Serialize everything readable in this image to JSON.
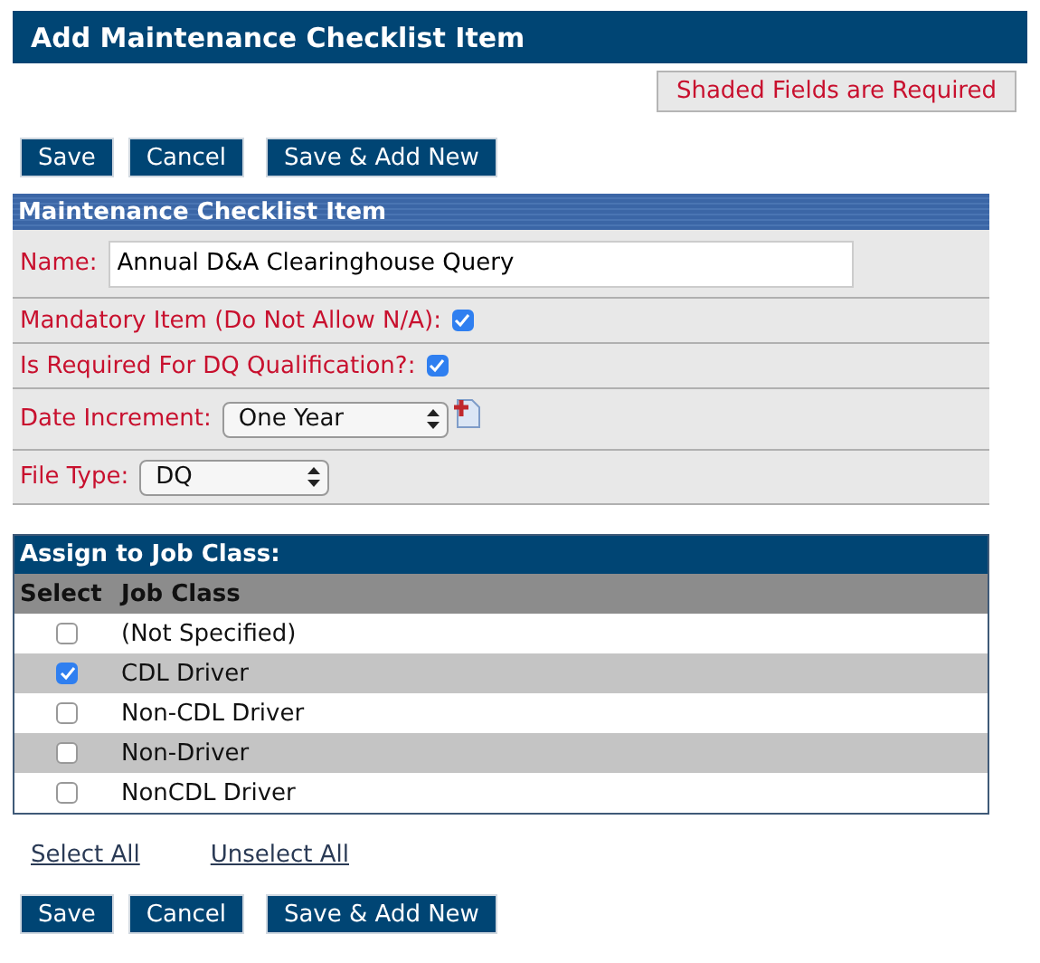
{
  "title": "Add Maintenance Checklist Item",
  "required_note": "Shaded Fields are Required",
  "top_buttons": [
    "Save",
    "Cancel",
    "Save & Add New"
  ],
  "section": {
    "title": "Maintenance Checklist Item",
    "fields": [
      {
        "kind": "text",
        "label": "Name:",
        "value": "Annual D&A Clearinghouse Query"
      },
      {
        "kind": "checkbox",
        "label": "Mandatory Item (Do Not Allow N/A):",
        "checked": true
      },
      {
        "kind": "checkbox",
        "label": "Is Required For DQ Qualification?:",
        "checked": true
      },
      {
        "kind": "select",
        "label": "Date Increment:",
        "value": "One Year",
        "add_icon": true
      },
      {
        "kind": "select",
        "label": "File Type:",
        "value": "DQ",
        "add_icon": false
      }
    ]
  },
  "job_class": {
    "title": "Assign to Job Class:",
    "columns": [
      "Select",
      "Job Class"
    ],
    "rows": [
      {
        "name": "(Not Specified)",
        "checked": false
      },
      {
        "name": "CDL Driver",
        "checked": true
      },
      {
        "name": "Non-CDL Driver",
        "checked": false
      },
      {
        "name": "Non-Driver",
        "checked": false
      },
      {
        "name": "NonCDL Driver",
        "checked": false
      }
    ]
  },
  "links": [
    "Select All",
    "Unselect All"
  ],
  "bottom_buttons": [
    "Save",
    "Cancel",
    "Save & Add New"
  ]
}
